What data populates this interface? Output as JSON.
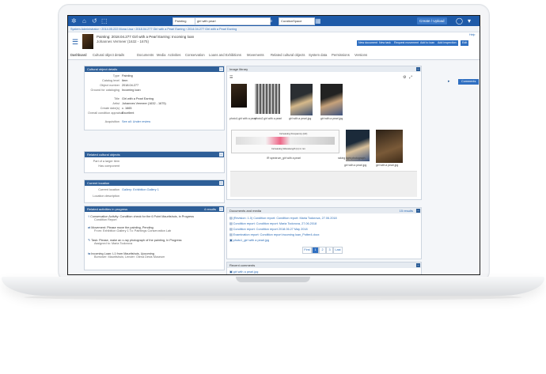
{
  "topbar": {
    "source": "Painting",
    "search_value": "girl with pearl",
    "space": "CurationSpace",
    "create_upload": "Create / Upload"
  },
  "breadcrumbs": {
    "items": [
      "System Administrator",
      "2014.05.222 Mona Lisa",
      "2018.04.277 Girl with a Pearl Earring",
      "2014.04.277 Girl with a Pearl Earring"
    ]
  },
  "header": {
    "line1": "Painting: 2018.04.277 Girl with a Pearl Earring: Incoming loan",
    "line2": "Johannes Vermeer (1632 - 1675)",
    "help": "Help",
    "buttons": [
      "New document",
      "New task",
      "Request movement",
      "Add to loan",
      "Add inspection",
      "Edit"
    ]
  },
  "tabs": [
    "Dashboard",
    "Cultural object details",
    "Documents",
    "Media",
    "Activities",
    "Conservation",
    "Loans and Exhibitions",
    "Movements",
    "Related cultural objects",
    "System data",
    "Permissions",
    "Versions"
  ],
  "comments_button": "Comments",
  "details": {
    "title": "Cultural object details",
    "rows": [
      {
        "label": "Type",
        "value": "Painting"
      },
      {
        "label": "Catalog level",
        "value": "Item"
      },
      {
        "label": "Object number",
        "value": "2018.04.277"
      },
      {
        "label": "Ground for cataloging",
        "value": "Incoming loan"
      },
      {
        "label": "Title",
        "value": "Girl with a Pearl Earring"
      },
      {
        "label": "Artist",
        "value": "Johannes Vermeer (1632 - 1675)"
      },
      {
        "label": "Create date(s)",
        "value": "c. 1665"
      },
      {
        "label": "Overall condition appraisal",
        "value": "Excellent"
      },
      {
        "label": "Acquisition",
        "value": "See all: Under review"
      }
    ]
  },
  "related": {
    "title": "Related cultural objects",
    "rows": [
      {
        "label": "Part of a larger item",
        "value": ""
      },
      {
        "label": "Has component",
        "value": ""
      }
    ]
  },
  "location": {
    "title": "Current location",
    "rows": [
      {
        "label": "Current location",
        "value": "Gallery: Exhibition Gallery 1"
      },
      {
        "label": "Location description",
        "value": ""
      }
    ]
  },
  "activities": {
    "title": "Related activities in progress",
    "count": "4 results",
    "items": [
      {
        "text": "Conservation Activity: Condition check for the 6 Point Mauritshuis, in Progress",
        "sub": "Condition Report"
      },
      {
        "text": "Movement: Please move the painting, Pending",
        "sub": "From: Exhibition Gallery 1 To: Paintings Conservation Lab"
      },
      {
        "text": "Task: Please, make an x-ray photograph of the painting, In Progress",
        "sub": "Assigned to: Maria Todorova"
      },
      {
        "text": "Incoming Loan: L1 from Mauritshuis, Upcoming",
        "sub": "Borrower: Mauritshuis; Lender: Olena Desis Museum"
      }
    ]
  },
  "images": {
    "title": "Image library",
    "captions": [
      "photo1.girl with a pearl",
      "photo2.girl with a pearl",
      "girl with a pearl.jpg",
      "girl with a pearl.jpg",
      "IR spectrum_girl with a pearl",
      "girl with a pearl.jpg",
      "raking light photograph",
      "girl with a pearl.jpg"
    ],
    "chart_title": "Increasing Frequency (Hz)",
    "chart_axis": "Increasing Wavelength (λ) in nm"
  },
  "documents": {
    "title": "Documents and media",
    "count": "15 results",
    "items": [
      "(Revision: 1.0) Condition report: Condition report: Maria Todorova, 27.06.2018",
      "Condition report: Condition report: Maria Todorova, 27.06.2018",
      "Condition report: Condition report 2018.06.27 May 2018",
      "Examination report: Condition report incoming loan_Potter4.docx",
      "photo1_girl with a pearl.jpg"
    ],
    "pages": [
      "First",
      "1",
      "2",
      "3",
      "Last"
    ]
  },
  "recent": {
    "title": "Recent comments",
    "item": "girl with a pearl.jpg"
  },
  "colors": {
    "accent": "#1e5aa8",
    "panel_header": "#2e5f98",
    "link": "#2a6bb6"
  }
}
